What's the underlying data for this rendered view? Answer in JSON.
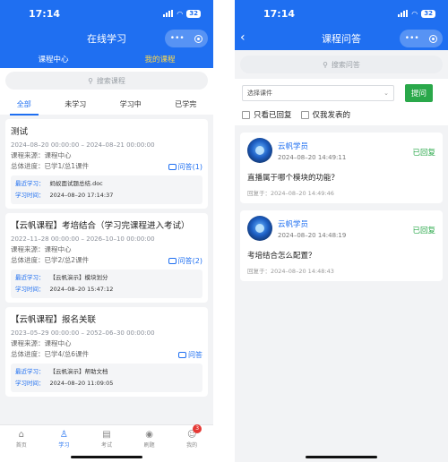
{
  "status": {
    "time": "17:14",
    "battery": "32"
  },
  "left": {
    "title": "在线学习",
    "top_tabs": [
      {
        "label": "课程中心",
        "active": false
      },
      {
        "label": "我的课程",
        "active": true
      }
    ],
    "search_placeholder": "搜索课程",
    "filter_tabs": [
      {
        "label": "全部",
        "active": true
      },
      {
        "label": "未学习",
        "active": false
      },
      {
        "label": "学习中",
        "active": false
      },
      {
        "label": "已学完",
        "active": false
      }
    ],
    "cards": [
      {
        "title": "测试",
        "dates": "2024–08–20 00:00:00 – 2024–08–21 00:00:00",
        "source": "课程来源：课程中心",
        "progress": "总体进度：已学1/总1课件",
        "qa": "问答(1)",
        "recent_key": "最近学习：",
        "recent_val": "蚂蚁面试题总结.doc",
        "time_key": "学习时间：",
        "time_val": "2024–08–20 17:14:37"
      },
      {
        "title": "【云帆课程】考培结合（学习完课程进入考试）",
        "dates": "2022–11–28 00:00:00 – 2026–10–10 00:00:00",
        "source": "课程来源：课程中心",
        "progress": "总体进度：已学2/总2课件",
        "qa": "问答(2)",
        "recent_key": "最近学习：",
        "recent_val": "【云帆演示】模块划分",
        "time_key": "学习时间：",
        "time_val": "2024–08–20 15:47:12"
      },
      {
        "title": "【云帆课程】报名关联",
        "dates": "2023–05–29 00:00:00 – 2052–06–30 00:00:00",
        "source": "课程来源：课程中心",
        "progress": "总体进度：已学4/总6课件",
        "qa": "问答",
        "recent_key": "最近学习：",
        "recent_val": "【云帆演示】帮助文档",
        "time_key": "学习时间：",
        "time_val": "2024–08–20 11:09:05"
      }
    ],
    "bottom_nav": [
      {
        "label": "首页",
        "icon": "home-icon",
        "glyph": "⌂",
        "active": false
      },
      {
        "label": "学习",
        "icon": "study-icon",
        "glyph": "♙",
        "active": true
      },
      {
        "label": "考试",
        "icon": "exam-icon",
        "glyph": "▤",
        "active": false
      },
      {
        "label": "刷题",
        "icon": "practice-icon",
        "glyph": "◉",
        "active": false
      },
      {
        "label": "我的",
        "icon": "profile-icon",
        "glyph": "☺",
        "active": false,
        "badge": "3"
      }
    ]
  },
  "right": {
    "title": "课程问答",
    "search_placeholder": "搜索问答",
    "select_label": "选择课件",
    "ask_button": "提问",
    "check_replied": "只看已回复",
    "check_mine": "仅我发表的",
    "questions": [
      {
        "author": "云帆学员",
        "time": "2024–08–20 14:49:11",
        "status": "已回复",
        "text": "直播属于哪个模块的功能？",
        "reply": "回复于：2024–08–20 14:49:46"
      },
      {
        "author": "云帆学员",
        "time": "2024–08–20 14:48:19",
        "status": "已回复",
        "text": "考培结合怎么配置？",
        "reply": "回复于：2024–08–20 14:48:43"
      }
    ]
  },
  "colors": {
    "brand": "#1f6ff1",
    "accent_yellow": "#ffd94a",
    "green": "#2aa84a",
    "badge_red": "#e53935"
  }
}
